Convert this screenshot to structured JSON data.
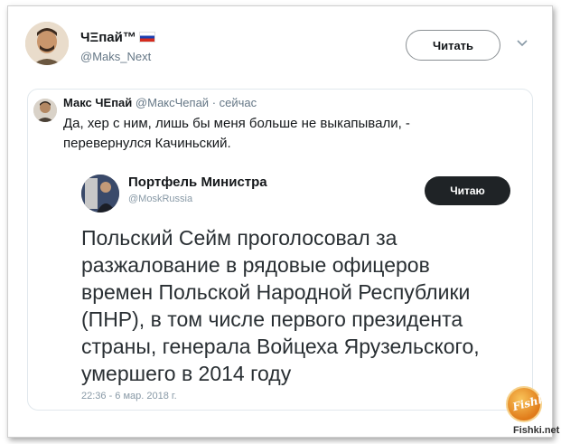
{
  "tweet": {
    "author_name": "ЧΞпай™",
    "author_handle": "@Maks_Next",
    "read_button_label": "Читать",
    "flag": "russia-flag-icon"
  },
  "quoted": {
    "author_name": "Макс ЧЕпай",
    "author_handle": "@МаксЧепай",
    "separator": "·",
    "time": "сейчас",
    "text_line1": "Да, хер с ним, лишь бы меня больше не выкапывали, -",
    "text_line2": "перевернулся Качиньский."
  },
  "embedded": {
    "author_name": "Портфель Министра",
    "author_handle": "@MoskRussia",
    "button_label": "Читаю",
    "text_lines": [
      "Польский Сейм проголосовал за",
      "разжалование в рядовые офицеров",
      "времен Польской Народной Республики",
      "(ПНР), в том числе первого президента",
      "страны, генерала Войцеха Ярузельского,",
      "умершего в 2014 году"
    ],
    "timestamp": "22:36 - 6 мар. 2018 г."
  },
  "watermark": {
    "logo_text": "Fishki",
    "site": "Fishki.net"
  },
  "colors": {
    "text": "#14171a",
    "muted": "#657786",
    "border": "#e1e8ed",
    "dark_button": "#1f2326"
  }
}
